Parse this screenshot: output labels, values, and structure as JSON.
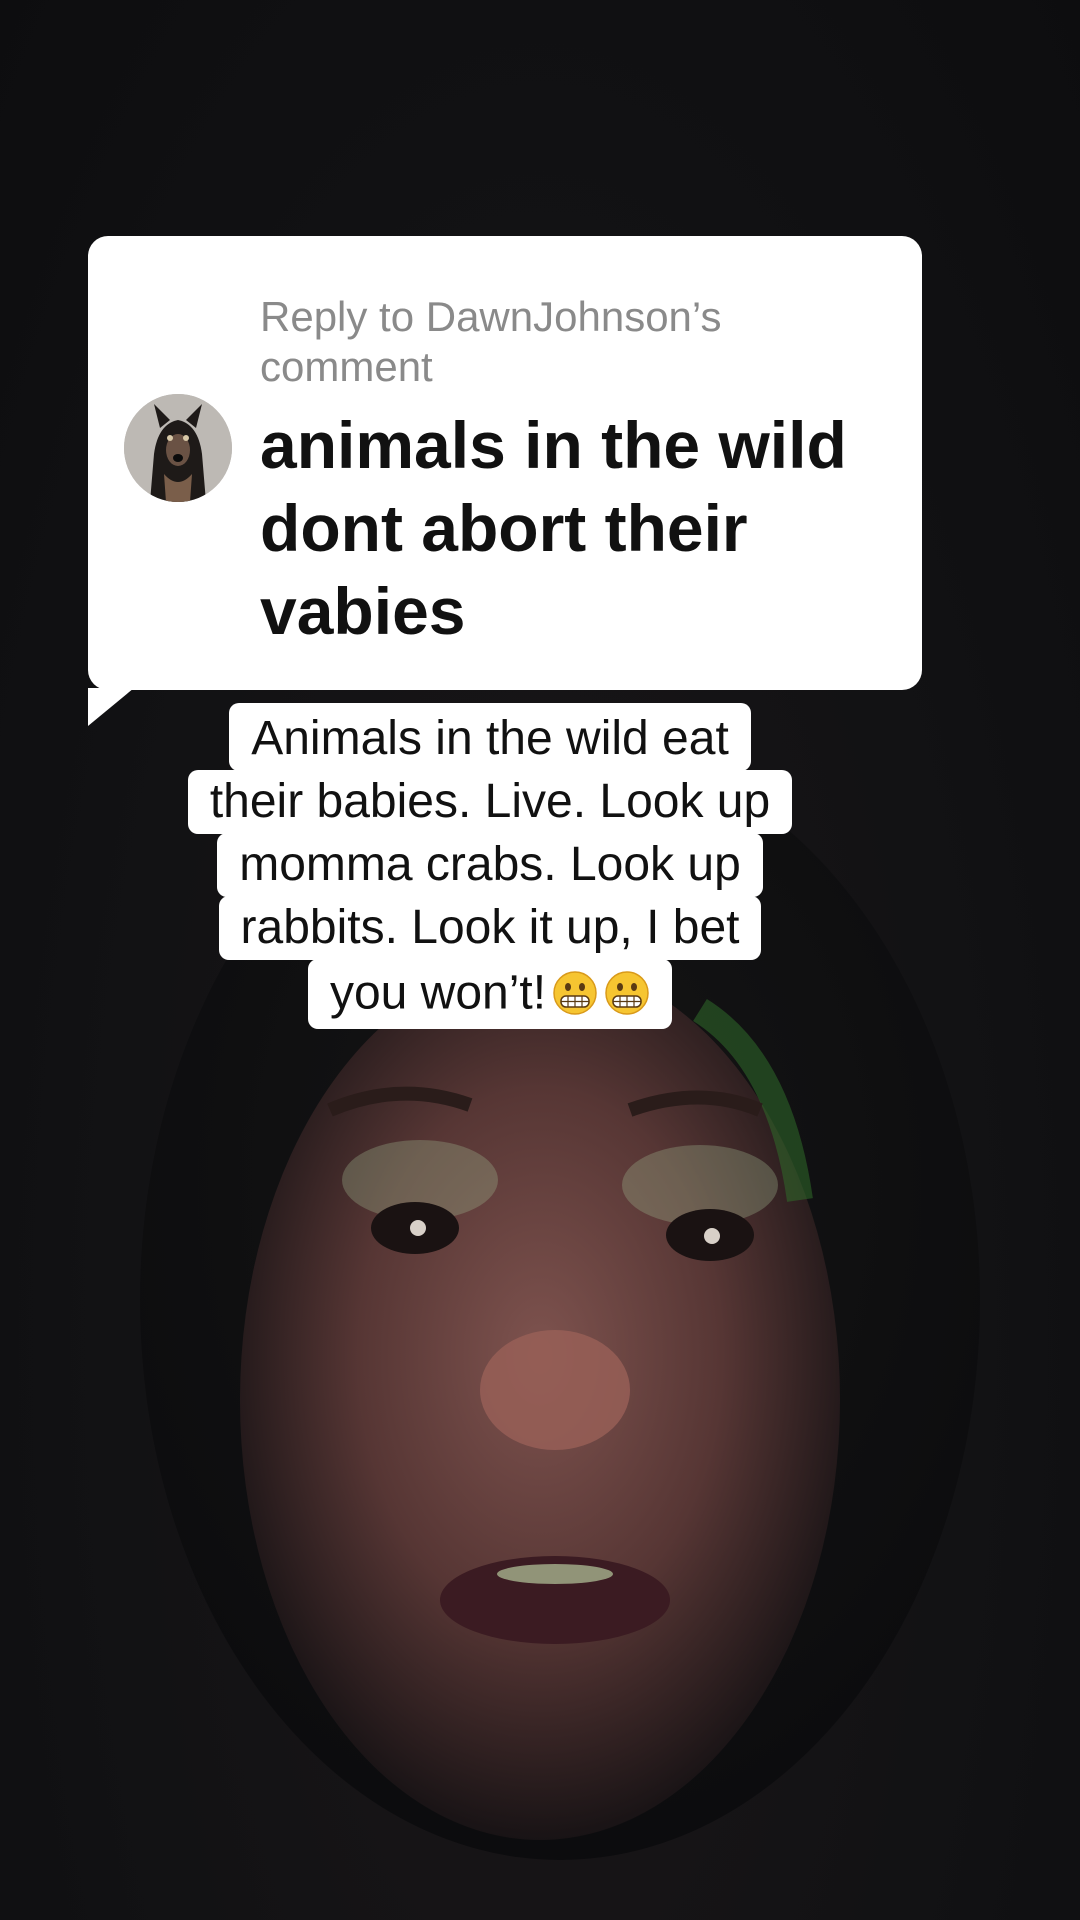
{
  "reply": {
    "header": "Reply to DawnJohnson’s comment",
    "comment": "animals in the wild dont abort their vabies"
  },
  "caption": {
    "lines": [
      "Animals in the wild eat",
      "their babies. Live. Look up",
      "momma crabs. Look up",
      "rabbits. Look it up, I bet",
      "you won’t!"
    ],
    "emoji_icons": [
      "grimacing-face-icon",
      "grimacing-face-icon"
    ]
  },
  "colors": {
    "bubble": "#ffffff",
    "reply_header": "#8a8a8a",
    "comment_text": "#111111",
    "background": "#111113"
  }
}
